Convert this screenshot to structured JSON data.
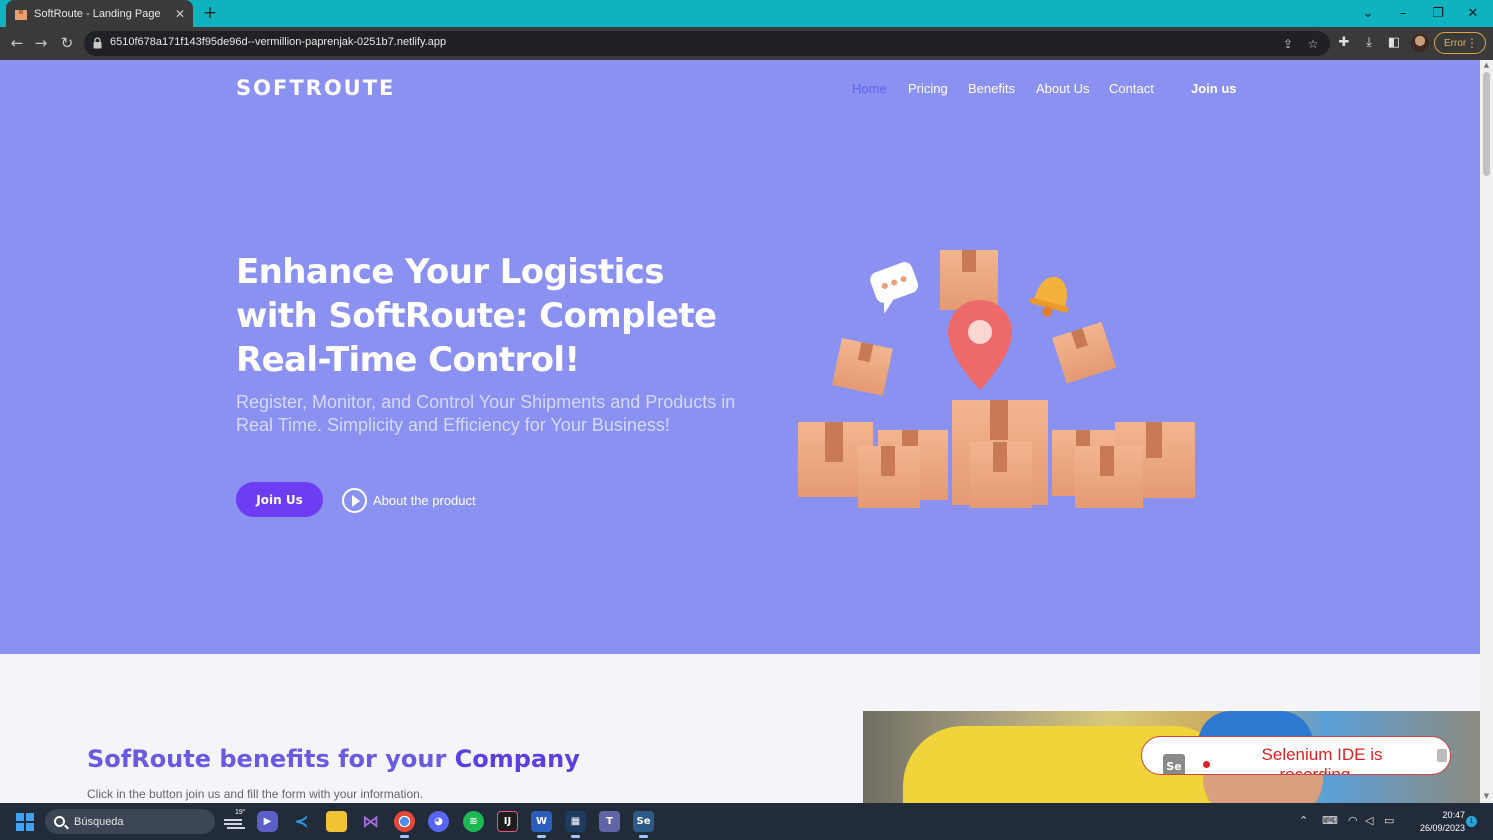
{
  "browser": {
    "tab_title": "SoftRoute - Landing Page",
    "url": "6510f678a171f143f95de96d--vermillion-paprenjak-0251b7.netlify.app",
    "error_label": "Error"
  },
  "page": {
    "logo": "SOFTROUTE",
    "nav": {
      "home": "Home",
      "pricing": "Pricing",
      "benefits": "Benefits",
      "about": "About Us",
      "contact": "Contact",
      "join": "Join us"
    },
    "hero": {
      "headline": "Enhance Your Logistics with SoftRoute: Complete Real-Time Control!",
      "subhead": "Register, Monitor, and Control Your Shipments and Products in Real Time. Simplicity and Efficiency for Your Business!",
      "cta_label": "Join Us",
      "about_label": "About the product"
    },
    "benefits": {
      "title_prefix": "SofRoute benefits for your ",
      "title_emphasis": "Company",
      "subtitle": "Click in the button join us and fill the form with your information."
    }
  },
  "selenium": {
    "logo_text": "Se",
    "status": "Selenium IDE is recording..."
  },
  "taskbar": {
    "search_placeholder": "Búsqueda",
    "temperature": "19°",
    "time": "20:47",
    "date": "26/09/2023",
    "notification_count": "1"
  },
  "colors": {
    "hero_bg": "#8a91f1",
    "accent": "#6d3cf3",
    "tab_strip": "#0fb3bf"
  }
}
